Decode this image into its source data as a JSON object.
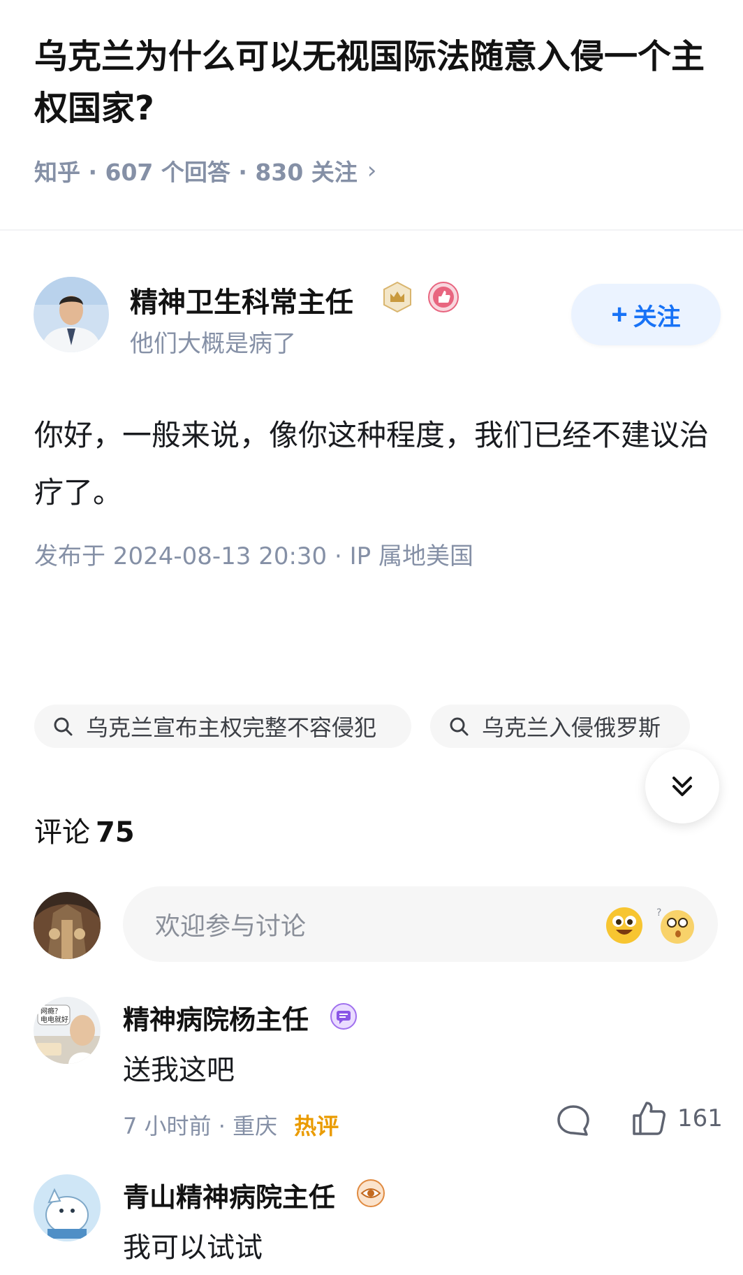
{
  "question": {
    "title": "乌克兰为什么可以无视国际法随意入侵一个主权国家?",
    "meta": "知乎 · 607 个回答 · 830 关注",
    "chevron": "›"
  },
  "author": {
    "name": "精神卫生科常主任",
    "bio": "他们大概是病了",
    "follow_label": "关注",
    "follow_plus": "+"
  },
  "answer": {
    "text": "你好，一般来说，像你这种程度，我们已经不建议治疗了。",
    "meta": "发布于 2024-08-13 20:30 · IP 属地美国"
  },
  "related_searches": [
    {
      "label": "乌克兰宣布主权完整不容侵犯",
      "icon": "search-icon"
    },
    {
      "label": "乌克兰入侵俄罗斯",
      "icon": "search-icon"
    }
  ],
  "comments_section": {
    "title": "评论",
    "count": "75",
    "input_placeholder": "欢迎参与讨论"
  },
  "comments": [
    {
      "name": "精神病院杨主任",
      "text": "送我这吧",
      "time": "7 小时前",
      "location": "重庆",
      "tag": "热评",
      "likes": "161"
    },
    {
      "name": "青山精神病院主任",
      "text": "我可以试试"
    }
  ],
  "avatar_texts": {
    "line1": "网瘾？",
    "line2": "电电就好"
  },
  "colors": {
    "accent": "#1772f6",
    "meta_gray": "#8590a6",
    "hot_tag": "#ea9b00"
  }
}
